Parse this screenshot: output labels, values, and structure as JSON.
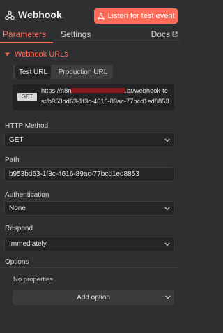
{
  "node": {
    "title": "Webhook",
    "icon": "webhook-icon"
  },
  "header": {
    "listen_button": "Listen for test event",
    "listen_icon": "flask-icon"
  },
  "tabs": [
    {
      "label": "Parameters",
      "active": true
    },
    {
      "label": "Settings",
      "active": false
    }
  ],
  "docs": {
    "label": "Docs",
    "icon": "external-link-icon"
  },
  "webhook_urls": {
    "section_label": "Webhook URLs",
    "tabs": [
      {
        "label": "Test URL",
        "active": true
      },
      {
        "label": "Production URL",
        "active": false
      }
    ],
    "method": "GET",
    "url_prefix": "https://n8n",
    "url_suffix": ".br/webhook-te",
    "url_line2": "st/b953bd63-1f3c-4616-89ac-77bcd1ed8853"
  },
  "fields": {
    "http_method": {
      "label": "HTTP Method",
      "value": "GET"
    },
    "path": {
      "label": "Path",
      "value": "b953bd63-1f3c-4616-89ac-77bcd1ed8853"
    },
    "authentication": {
      "label": "Authentication",
      "value": "None"
    },
    "respond": {
      "label": "Respond",
      "value": "Immediately"
    }
  },
  "options": {
    "label": "Options",
    "empty_text": "No properties",
    "add_button": "Add option"
  },
  "colors": {
    "accent": "#ff6d5a",
    "background": "#2f2f31",
    "redaction": "#8b1a1f"
  }
}
